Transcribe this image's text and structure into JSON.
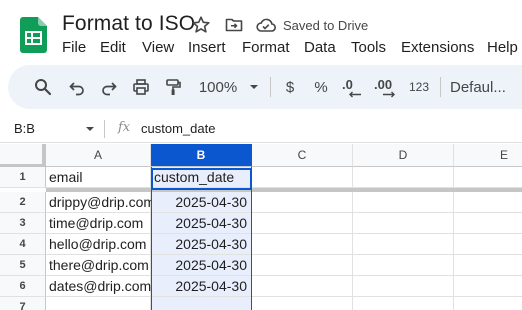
{
  "app": {
    "doc_title": "Format to ISO",
    "save_status": "Saved to Drive",
    "brand_color": "#0f9d58",
    "accent_color": "#0b57d0"
  },
  "menu": [
    "File",
    "Edit",
    "View",
    "Insert",
    "Format",
    "Data",
    "Tools",
    "Extensions",
    "Help"
  ],
  "toolbar": {
    "icons": [
      "search-icon",
      "undo-icon",
      "redo-icon",
      "print-icon",
      "paint-format-icon"
    ],
    "zoom": "100%",
    "currency": "$",
    "percent": "%",
    "decrease_decimal": ".0",
    "increase_decimal": ".00",
    "number_format": "123",
    "font": "Defaul..."
  },
  "formula_bar": {
    "name_box": "B:B",
    "fx": "fx",
    "content": "custom_date"
  },
  "grid": {
    "columns": [
      "A",
      "B",
      "C",
      "D",
      "E"
    ],
    "selected_column": "B",
    "rows": [
      {
        "num": "1",
        "a": "email",
        "b": "custom_date"
      },
      {
        "num": "2",
        "a": "drippy@drip.com",
        "b": "2025-04-30"
      },
      {
        "num": "3",
        "a": "time@drip.com",
        "b": "2025-04-30"
      },
      {
        "num": "4",
        "a": "hello@drip.com",
        "b": "2025-04-30"
      },
      {
        "num": "5",
        "a": "there@drip.com",
        "b": "2025-04-30"
      },
      {
        "num": "6",
        "a": "dates@drip.com",
        "b": "2025-04-30"
      },
      {
        "num": "7",
        "a": "",
        "b": ""
      }
    ]
  }
}
